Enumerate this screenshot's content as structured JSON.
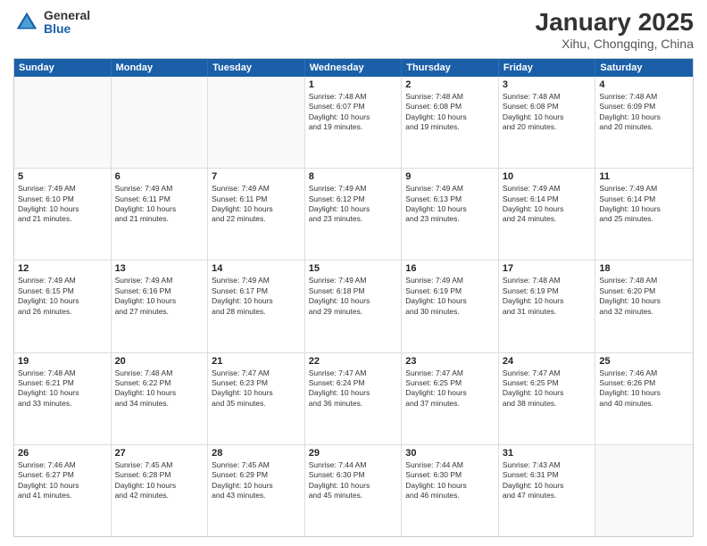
{
  "header": {
    "logo_general": "General",
    "logo_blue": "Blue",
    "title": "January 2025",
    "subtitle": "Xihu, Chongqing, China"
  },
  "days_of_week": [
    "Sunday",
    "Monday",
    "Tuesday",
    "Wednesday",
    "Thursday",
    "Friday",
    "Saturday"
  ],
  "weeks": [
    [
      {
        "day": "",
        "info": ""
      },
      {
        "day": "",
        "info": ""
      },
      {
        "day": "",
        "info": ""
      },
      {
        "day": "1",
        "info": "Sunrise: 7:48 AM\nSunset: 6:07 PM\nDaylight: 10 hours\nand 19 minutes."
      },
      {
        "day": "2",
        "info": "Sunrise: 7:48 AM\nSunset: 6:08 PM\nDaylight: 10 hours\nand 19 minutes."
      },
      {
        "day": "3",
        "info": "Sunrise: 7:48 AM\nSunset: 6:08 PM\nDaylight: 10 hours\nand 20 minutes."
      },
      {
        "day": "4",
        "info": "Sunrise: 7:48 AM\nSunset: 6:09 PM\nDaylight: 10 hours\nand 20 minutes."
      }
    ],
    [
      {
        "day": "5",
        "info": "Sunrise: 7:49 AM\nSunset: 6:10 PM\nDaylight: 10 hours\nand 21 minutes."
      },
      {
        "day": "6",
        "info": "Sunrise: 7:49 AM\nSunset: 6:11 PM\nDaylight: 10 hours\nand 21 minutes."
      },
      {
        "day": "7",
        "info": "Sunrise: 7:49 AM\nSunset: 6:11 PM\nDaylight: 10 hours\nand 22 minutes."
      },
      {
        "day": "8",
        "info": "Sunrise: 7:49 AM\nSunset: 6:12 PM\nDaylight: 10 hours\nand 23 minutes."
      },
      {
        "day": "9",
        "info": "Sunrise: 7:49 AM\nSunset: 6:13 PM\nDaylight: 10 hours\nand 23 minutes."
      },
      {
        "day": "10",
        "info": "Sunrise: 7:49 AM\nSunset: 6:14 PM\nDaylight: 10 hours\nand 24 minutes."
      },
      {
        "day": "11",
        "info": "Sunrise: 7:49 AM\nSunset: 6:14 PM\nDaylight: 10 hours\nand 25 minutes."
      }
    ],
    [
      {
        "day": "12",
        "info": "Sunrise: 7:49 AM\nSunset: 6:15 PM\nDaylight: 10 hours\nand 26 minutes."
      },
      {
        "day": "13",
        "info": "Sunrise: 7:49 AM\nSunset: 6:16 PM\nDaylight: 10 hours\nand 27 minutes."
      },
      {
        "day": "14",
        "info": "Sunrise: 7:49 AM\nSunset: 6:17 PM\nDaylight: 10 hours\nand 28 minutes."
      },
      {
        "day": "15",
        "info": "Sunrise: 7:49 AM\nSunset: 6:18 PM\nDaylight: 10 hours\nand 29 minutes."
      },
      {
        "day": "16",
        "info": "Sunrise: 7:49 AM\nSunset: 6:19 PM\nDaylight: 10 hours\nand 30 minutes."
      },
      {
        "day": "17",
        "info": "Sunrise: 7:48 AM\nSunset: 6:19 PM\nDaylight: 10 hours\nand 31 minutes."
      },
      {
        "day": "18",
        "info": "Sunrise: 7:48 AM\nSunset: 6:20 PM\nDaylight: 10 hours\nand 32 minutes."
      }
    ],
    [
      {
        "day": "19",
        "info": "Sunrise: 7:48 AM\nSunset: 6:21 PM\nDaylight: 10 hours\nand 33 minutes."
      },
      {
        "day": "20",
        "info": "Sunrise: 7:48 AM\nSunset: 6:22 PM\nDaylight: 10 hours\nand 34 minutes."
      },
      {
        "day": "21",
        "info": "Sunrise: 7:47 AM\nSunset: 6:23 PM\nDaylight: 10 hours\nand 35 minutes."
      },
      {
        "day": "22",
        "info": "Sunrise: 7:47 AM\nSunset: 6:24 PM\nDaylight: 10 hours\nand 36 minutes."
      },
      {
        "day": "23",
        "info": "Sunrise: 7:47 AM\nSunset: 6:25 PM\nDaylight: 10 hours\nand 37 minutes."
      },
      {
        "day": "24",
        "info": "Sunrise: 7:47 AM\nSunset: 6:25 PM\nDaylight: 10 hours\nand 38 minutes."
      },
      {
        "day": "25",
        "info": "Sunrise: 7:46 AM\nSunset: 6:26 PM\nDaylight: 10 hours\nand 40 minutes."
      }
    ],
    [
      {
        "day": "26",
        "info": "Sunrise: 7:46 AM\nSunset: 6:27 PM\nDaylight: 10 hours\nand 41 minutes."
      },
      {
        "day": "27",
        "info": "Sunrise: 7:45 AM\nSunset: 6:28 PM\nDaylight: 10 hours\nand 42 minutes."
      },
      {
        "day": "28",
        "info": "Sunrise: 7:45 AM\nSunset: 6:29 PM\nDaylight: 10 hours\nand 43 minutes."
      },
      {
        "day": "29",
        "info": "Sunrise: 7:44 AM\nSunset: 6:30 PM\nDaylight: 10 hours\nand 45 minutes."
      },
      {
        "day": "30",
        "info": "Sunrise: 7:44 AM\nSunset: 6:30 PM\nDaylight: 10 hours\nand 46 minutes."
      },
      {
        "day": "31",
        "info": "Sunrise: 7:43 AM\nSunset: 6:31 PM\nDaylight: 10 hours\nand 47 minutes."
      },
      {
        "day": "",
        "info": ""
      }
    ]
  ]
}
